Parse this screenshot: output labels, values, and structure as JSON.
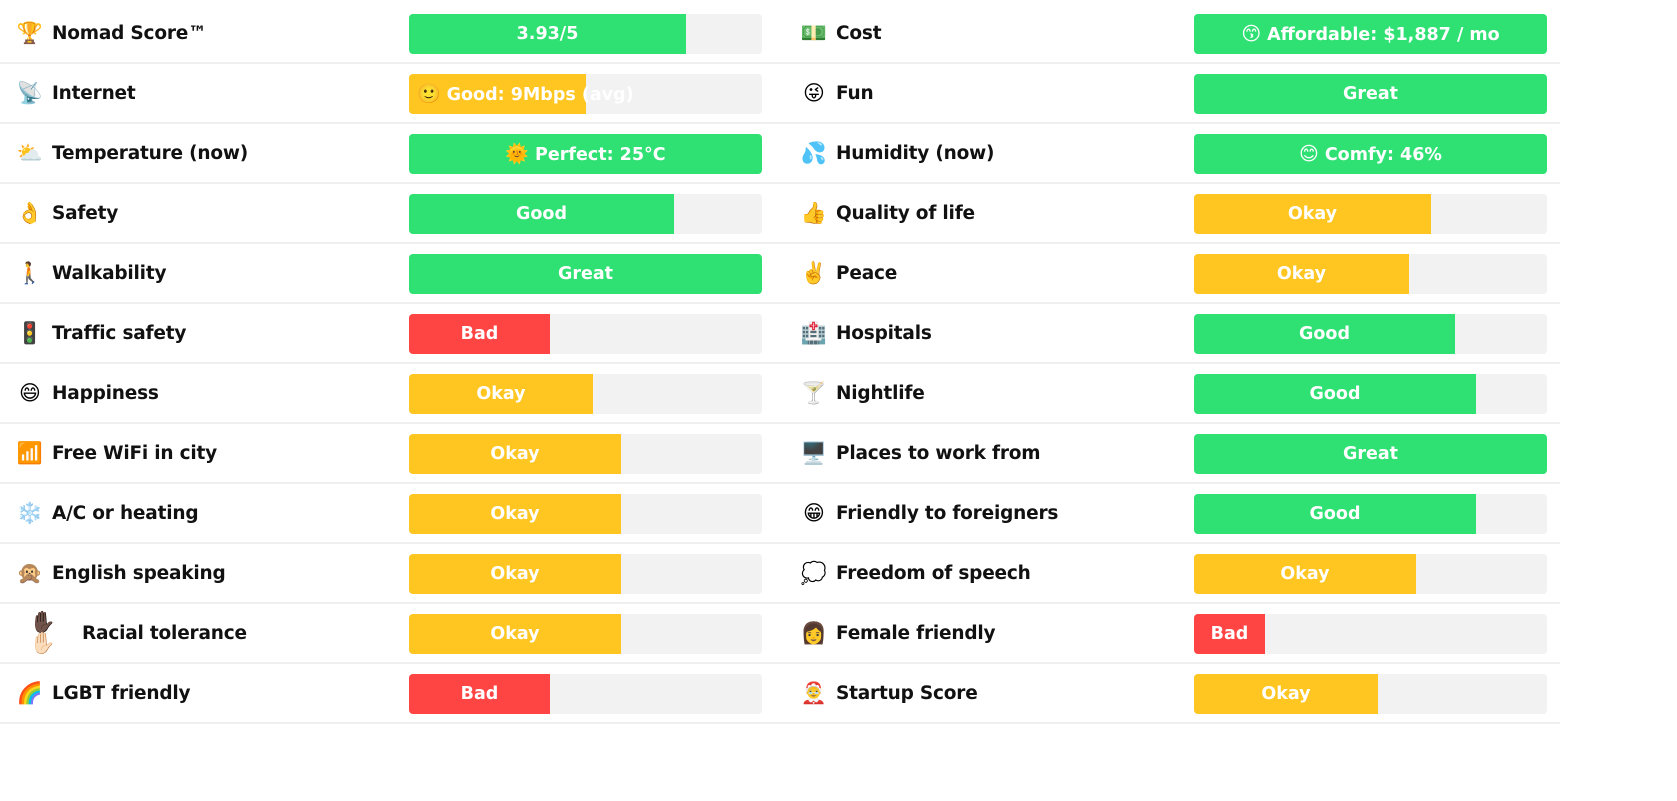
{
  "colors": {
    "great": "#2fe073",
    "good": "#2fe073",
    "okay": "#ffc621",
    "bad": "#ff4444",
    "track": "#f2f2f2"
  },
  "left": [
    {
      "icon": "🏆",
      "icon_name": "trophy-icon",
      "label": "Nomad Score™",
      "value": "3.93/5",
      "value_icon": "",
      "rating": "good",
      "fill": 0.786
    },
    {
      "icon": "📡",
      "icon_name": "satellite-antenna-icon",
      "label": "Internet",
      "value": "Good: 9Mbps (avg)",
      "value_icon": "🙂",
      "rating": "okay",
      "fill": 0.5
    },
    {
      "icon": "⛅",
      "icon_name": "sun-behind-cloud-icon",
      "label": "Temperature (now)",
      "value": "Perfect: 25°C",
      "value_icon": "🌞",
      "rating": "great",
      "fill": 1.0
    },
    {
      "icon": "👌",
      "icon_name": "ok-hand-icon",
      "label": "Safety",
      "value": "Good",
      "value_icon": "",
      "rating": "good",
      "fill": 0.75
    },
    {
      "icon": "🚶",
      "icon_name": "person-walking-icon",
      "label": "Walkability",
      "value": "Great",
      "value_icon": "",
      "rating": "great",
      "fill": 1.0
    },
    {
      "icon": "🚦",
      "icon_name": "traffic-light-icon",
      "label": "Traffic safety",
      "value": "Bad",
      "value_icon": "",
      "rating": "bad",
      "fill": 0.4
    },
    {
      "icon": "😄",
      "icon_name": "grinning-face-icon",
      "label": "Happiness",
      "value": "Okay",
      "value_icon": "",
      "rating": "okay",
      "fill": 0.52
    },
    {
      "icon": "📶",
      "icon_name": "signal-bars-icon",
      "label": "Free WiFi in city",
      "value": "Okay",
      "value_icon": "",
      "rating": "okay",
      "fill": 0.6
    },
    {
      "icon": "❄️",
      "icon_name": "snowflake-icon",
      "label": "A/C or heating",
      "value": "Okay",
      "value_icon": "",
      "rating": "okay",
      "fill": 0.6
    },
    {
      "icon": "🙊",
      "icon_name": "speak-no-evil-monkey-icon",
      "label": "English speaking",
      "value": "Okay",
      "value_icon": "",
      "rating": "okay",
      "fill": 0.6
    },
    {
      "icon": "✋🏿✋🏻",
      "icon_name": "raised-hands-icon",
      "label": "Racial tolerance",
      "value": "Okay",
      "value_icon": "",
      "rating": "okay",
      "fill": 0.6,
      "wide": true
    },
    {
      "icon": "🌈",
      "icon_name": "rainbow-icon",
      "label": "LGBT friendly",
      "value": "Bad",
      "value_icon": "",
      "rating": "bad",
      "fill": 0.4
    }
  ],
  "right": [
    {
      "icon": "💵",
      "icon_name": "dollar-banknote-icon",
      "label": "Cost",
      "value": "Affordable: $1,887 / mo",
      "value_icon": "😙",
      "rating": "great",
      "fill": 1.0
    },
    {
      "icon": "😜",
      "icon_name": "tongue-face-icon",
      "label": "Fun",
      "value": "Great",
      "value_icon": "",
      "rating": "great",
      "fill": 1.0
    },
    {
      "icon": "💦",
      "icon_name": "sweat-droplets-icon",
      "label": "Humidity (now)",
      "value": "Comfy: 46%",
      "value_icon": "😊",
      "rating": "great",
      "fill": 1.0
    },
    {
      "icon": "👍",
      "icon_name": "thumbs-up-icon",
      "label": "Quality of life",
      "value": "Okay",
      "value_icon": "",
      "rating": "okay",
      "fill": 0.67
    },
    {
      "icon": "✌️",
      "icon_name": "victory-hand-icon",
      "label": "Peace",
      "value": "Okay",
      "value_icon": "",
      "rating": "okay",
      "fill": 0.61
    },
    {
      "icon": "🏥",
      "icon_name": "hospital-icon",
      "label": "Hospitals",
      "value": "Good",
      "value_icon": "",
      "rating": "good",
      "fill": 0.74
    },
    {
      "icon": "🍸",
      "icon_name": "cocktail-glass-icon",
      "label": "Nightlife",
      "value": "Good",
      "value_icon": "",
      "rating": "good",
      "fill": 0.8
    },
    {
      "icon": "🖥️",
      "icon_name": "desktop-computer-icon",
      "label": "Places to work from",
      "value": "Great",
      "value_icon": "",
      "rating": "great",
      "fill": 1.0
    },
    {
      "icon": "😁",
      "icon_name": "beaming-face-icon",
      "label": "Friendly to foreigners",
      "value": "Good",
      "value_icon": "",
      "rating": "good",
      "fill": 0.8
    },
    {
      "icon": "💭",
      "icon_name": "speech-balloon-icon",
      "label": "Freedom of speech",
      "value": "Okay",
      "value_icon": "",
      "rating": "okay",
      "fill": 0.63
    },
    {
      "icon": "👩",
      "icon_name": "woman-icon",
      "label": "Female friendly",
      "value": "Bad",
      "value_icon": "",
      "rating": "bad",
      "fill": 0.2
    },
    {
      "icon": "🤶",
      "icon_name": "santa-face-icon",
      "label": "Startup Score",
      "value": "Okay",
      "value_icon": "",
      "rating": "okay",
      "fill": 0.52
    }
  ]
}
